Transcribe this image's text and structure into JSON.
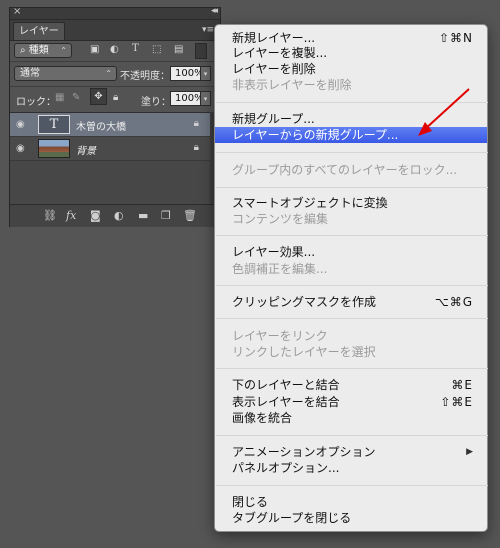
{
  "panel": {
    "close_glyph": "×",
    "collapse_glyph": "◂◂",
    "tab_label": "レイヤー",
    "menu_glyph": "▾≡",
    "filter": {
      "search_icon": "⌕",
      "label": "種類",
      "arrow": "⌃"
    },
    "blend_mode": "通常",
    "opacity_label": "不透明度：",
    "opacity_value": "100%",
    "lock_label": "ロック：",
    "fill_label": "塗り：",
    "fill_value": "100%",
    "layers": [
      {
        "name": "木曽の大橋",
        "type": "text",
        "selected": true
      },
      {
        "name": "背景",
        "type": "image",
        "selected": false
      }
    ],
    "bottom_icons": [
      "link-icon",
      "fx-icon",
      "mask-icon",
      "adjustment-icon",
      "folder-icon",
      "new-layer-icon",
      "trash-icon"
    ]
  },
  "menu": {
    "items": [
      {
        "label": "新規レイヤー...",
        "shortcut": "⇧⌘N",
        "disabled": false
      },
      {
        "label": "レイヤーを複製...",
        "shortcut": "",
        "disabled": false
      },
      {
        "label": "レイヤーを削除",
        "shortcut": "",
        "disabled": false
      },
      {
        "label": "非表示レイヤーを削除",
        "shortcut": "",
        "disabled": true
      },
      {
        "label": "新規グループ...",
        "shortcut": "",
        "disabled": false
      },
      {
        "label": "レイヤーからの新規グループ...",
        "shortcut": "",
        "disabled": false,
        "highlighted": true
      },
      {
        "label": "グループ内のすべてのレイヤーをロック...",
        "shortcut": "",
        "disabled": true
      },
      {
        "label": "スマートオブジェクトに変換",
        "shortcut": "",
        "disabled": false
      },
      {
        "label": "コンテンツを編集",
        "shortcut": "",
        "disabled": true
      },
      {
        "label": "レイヤー効果...",
        "shortcut": "",
        "disabled": false
      },
      {
        "label": "色調補正を編集...",
        "shortcut": "",
        "disabled": true
      },
      {
        "label": "クリッピングマスクを作成",
        "shortcut": "⌥⌘G",
        "disabled": false
      },
      {
        "label": "レイヤーをリンク",
        "shortcut": "",
        "disabled": true
      },
      {
        "label": "リンクしたレイヤーを選択",
        "shortcut": "",
        "disabled": true
      },
      {
        "label": "下のレイヤーと結合",
        "shortcut": "⌘E",
        "disabled": false
      },
      {
        "label": "表示レイヤーを結合",
        "shortcut": "⇧⌘E",
        "disabled": false
      },
      {
        "label": "画像を統合",
        "shortcut": "",
        "disabled": false
      },
      {
        "label": "アニメーションオプション",
        "shortcut": "",
        "disabled": false,
        "submenu": true
      },
      {
        "label": "パネルオプション...",
        "shortcut": "",
        "disabled": false
      },
      {
        "label": "閉じる",
        "shortcut": "",
        "disabled": false
      },
      {
        "label": "タブグループを閉じる",
        "shortcut": "",
        "disabled": false
      }
    ],
    "submenu_arrow": "▶"
  },
  "colors": {
    "desktop": "#555555",
    "panel": "#535353",
    "menu_bg": "#ececec",
    "highlight": "#3a59e6",
    "annotation_arrow": "#e00000"
  }
}
